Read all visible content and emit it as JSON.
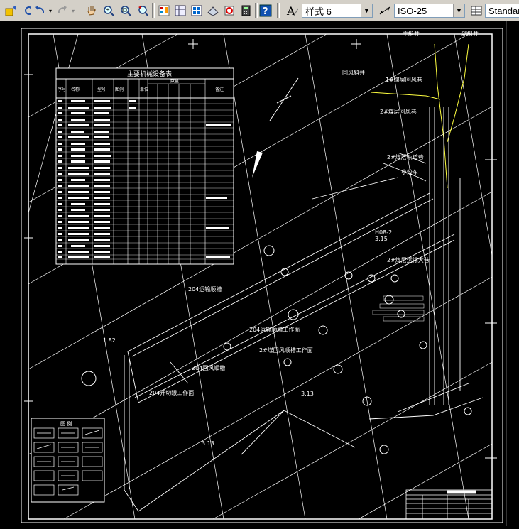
{
  "toolbar": {
    "text_style_label": "样式 6",
    "dim_style_label": "ISO-25",
    "table_style_label": "Standar"
  },
  "drawing": {
    "equipment_table_title": "主要机械设备表",
    "table_headers": [
      "序号",
      "名称",
      "型号",
      "图例",
      "单位",
      "数量",
      "备注"
    ],
    "labels": {
      "main_shaft": "主斜井",
      "aux_shaft": "副斜井",
      "return_shaft": "回风斜井",
      "return_roadway_1": "1#煤层回风巷",
      "return_roadway_2": "2#煤层回风巷",
      "track_roadway": "2#煤层轨道巷",
      "small_chamber": "小绞车",
      "transport_roadway": "2#煤层运输大巷",
      "belt_1": "204运输顺槽",
      "belt_2": "204运输顺槽",
      "face_1": "204运输顺槽工作面",
      "face_2": "2#煤回风顺槽工作面",
      "face_3": "204回风顺槽",
      "cut_face": "204开切眼工作面",
      "point_1": "1.82",
      "point_2": "3.13",
      "point_3": "3.13",
      "point_4": "3.15",
      "hole_label": "H08-2"
    },
    "legend_title": "图 例"
  }
}
